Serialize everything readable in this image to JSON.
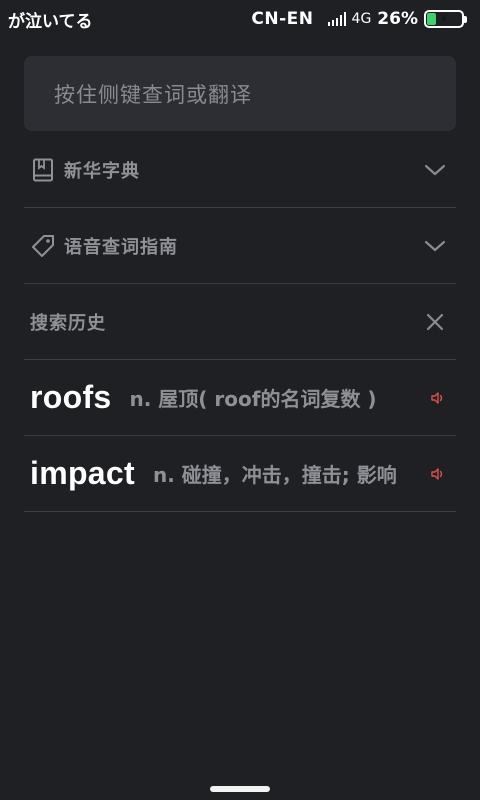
{
  "status_bar": {
    "left_text": "が泣いてる",
    "language_pair": "CN-EN",
    "network_type": "4G",
    "battery_percent": "26%",
    "battery_level": 0.26,
    "charging": true
  },
  "search": {
    "placeholder": "按住侧键查词或翻译"
  },
  "sections": [
    {
      "label": "新华字典",
      "icon": "book-icon",
      "action_icon": "chevron-down-icon"
    },
    {
      "label": "语音查词指南",
      "icon": "tag-icon",
      "action_icon": "chevron-down-icon"
    }
  ],
  "history": {
    "title": "搜索历史",
    "clear_icon": "close-icon",
    "items": [
      {
        "word": "roofs",
        "definition": "n. 屋顶( roof的名词复数 )"
      },
      {
        "word": "impact",
        "definition": "n. 碰撞，冲击，撞击; 影响"
      }
    ]
  },
  "colors": {
    "background": "#1f2024",
    "search_bg": "#2d2e33",
    "speaker_accent": "#e0524a",
    "battery_green": "#3fd26b"
  }
}
